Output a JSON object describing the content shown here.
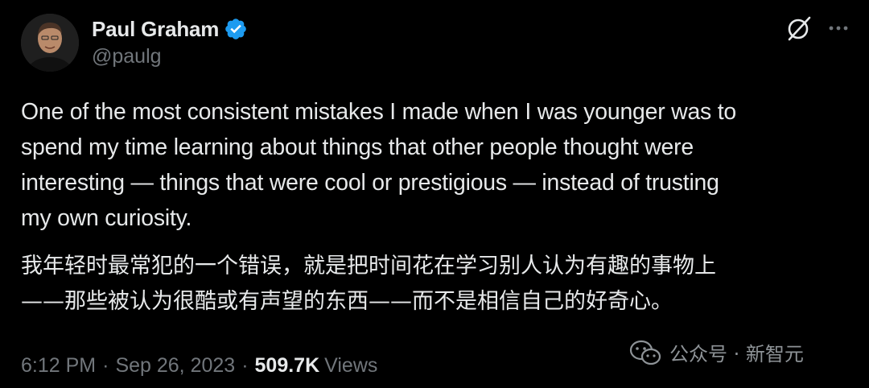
{
  "author": {
    "display_name": "Paul Graham",
    "handle": "@paulg",
    "verified": true
  },
  "icons": {
    "verified": "verified-badge-icon",
    "grok": "grok-icon",
    "more": "more-horizontal-icon",
    "watermark": "wechat-icon"
  },
  "tweet": {
    "text_en": "One of the most consistent mistakes I made when I was younger was to\nspend my time learning about things that other people thought were\ninteresting — things that were cool or prestigious — instead of trusting\nmy own curiosity.",
    "text_zh": "我年轻时最常犯的一个错误，就是把时间花在学习别人认为有趣的事物上\n——那些被认为很酷或有声望的东西——而不是相信自己的好奇心。"
  },
  "meta": {
    "time": "6:12 PM",
    "separator": "·",
    "date": "Sep 26, 2023",
    "views_count": "509.7K",
    "views_label": "Views"
  },
  "watermark": {
    "text": "公众号 · 新智元"
  },
  "colors": {
    "background": "#000000",
    "text_primary": "#e7e9ea",
    "text_secondary": "#71767b",
    "verified_blue": "#1d9bf0"
  }
}
